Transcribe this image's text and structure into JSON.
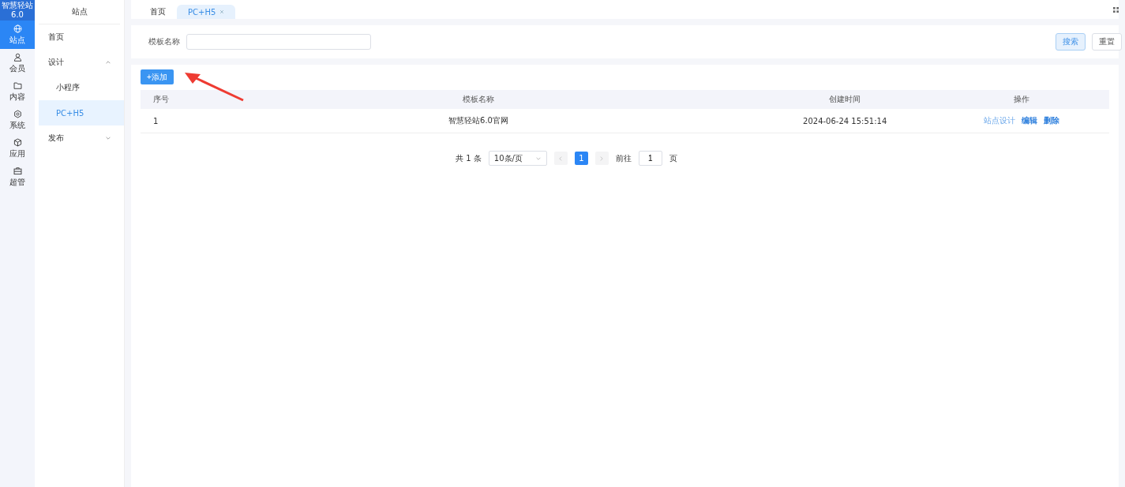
{
  "logo": {
    "text": "智慧轻站6.0"
  },
  "rail": [
    {
      "label": "站点",
      "selected": true
    },
    {
      "label": "会员",
      "selected": false
    },
    {
      "label": "内容",
      "selected": false
    },
    {
      "label": "系统",
      "selected": false
    },
    {
      "label": "应用",
      "selected": false
    },
    {
      "label": "超管",
      "selected": false
    }
  ],
  "sidebar": {
    "title": "站点",
    "items": [
      {
        "label": "首页",
        "selected": false
      },
      {
        "label": "设计",
        "expanded": true,
        "selected": false,
        "children": [
          {
            "label": "小程序",
            "selected": false
          },
          {
            "label": "PC+H5",
            "selected": true
          }
        ]
      },
      {
        "label": "发布",
        "expanded": false,
        "selected": false
      }
    ]
  },
  "tabs": [
    {
      "label": "首页",
      "selected": false,
      "closable": false
    },
    {
      "label": "PC+H5",
      "selected": true,
      "closable": true
    }
  ],
  "filter": {
    "label": "模板名称",
    "buttons": [
      {
        "label": "搜索",
        "kind": "primary"
      },
      {
        "label": "重置",
        "kind": "plain"
      }
    ]
  },
  "add_button": "+添加",
  "table": {
    "columns": [
      "序号",
      "模板名称",
      "创建时间",
      "操作"
    ],
    "rows": [
      {
        "cells": [
          "1",
          "智慧轻站6.0官网",
          "2024-06-24 15:51:14"
        ],
        "actions": [
          {
            "label": "站点设计",
            "strong": false
          },
          {
            "label": "编辑",
            "strong": true
          },
          {
            "label": "删除",
            "strong": true
          }
        ]
      }
    ]
  },
  "pagination": {
    "total": "共 1 条",
    "page_size": "10条/页",
    "pages": [
      {
        "label": "1",
        "selected": true
      }
    ],
    "goto_label": "前往",
    "goto_value": "1",
    "goto_suffix": "页"
  }
}
